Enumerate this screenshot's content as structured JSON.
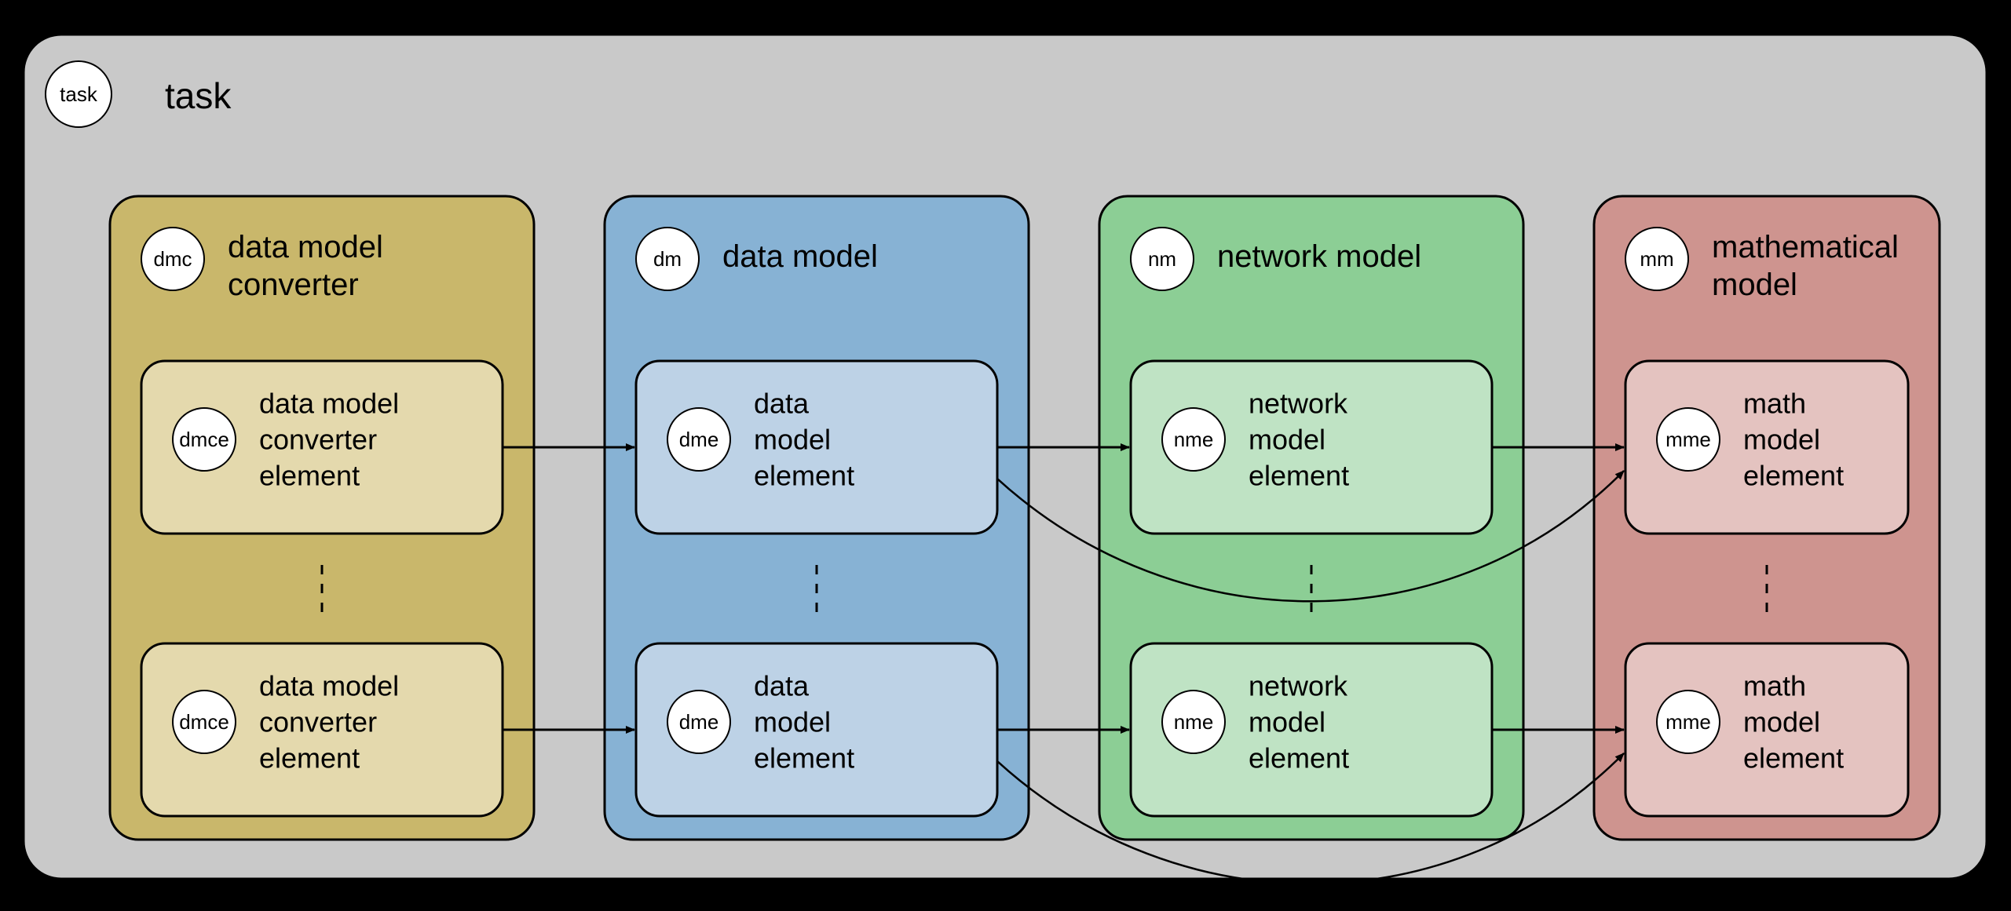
{
  "task": {
    "badge": "task",
    "title": "task"
  },
  "columns": {
    "dmc": {
      "badge": "dmc",
      "title_l1": "data model",
      "title_l2": "converter",
      "fill": "#c9b76b",
      "elem_fill": "#e4d9ad",
      "elem_badge": "dmce",
      "elem_l1": "data model",
      "elem_l2": "converter",
      "elem_l3": "element"
    },
    "dm": {
      "badge": "dm",
      "title": "data model",
      "fill": "#87b2d4",
      "elem_fill": "#bdd2e6",
      "elem_badge": "dme",
      "elem_l1": "data",
      "elem_l2": "model",
      "elem_l3": "element"
    },
    "nm": {
      "badge": "nm",
      "title": "network model",
      "fill": "#8cce95",
      "elem_fill": "#bfe3c4",
      "elem_badge": "nme",
      "elem_l1": "network",
      "elem_l2": "model",
      "elem_l3": "element"
    },
    "mm": {
      "badge": "mm",
      "title_l1": "mathematical",
      "title_l2": "model",
      "fill": "#ce948f",
      "elem_fill": "#e4c3c0",
      "elem_badge": "mme",
      "elem_l1": "math",
      "elem_l2": "model",
      "elem_l3": "element"
    }
  },
  "colors": {
    "task_bg": "#c9c9c9"
  }
}
